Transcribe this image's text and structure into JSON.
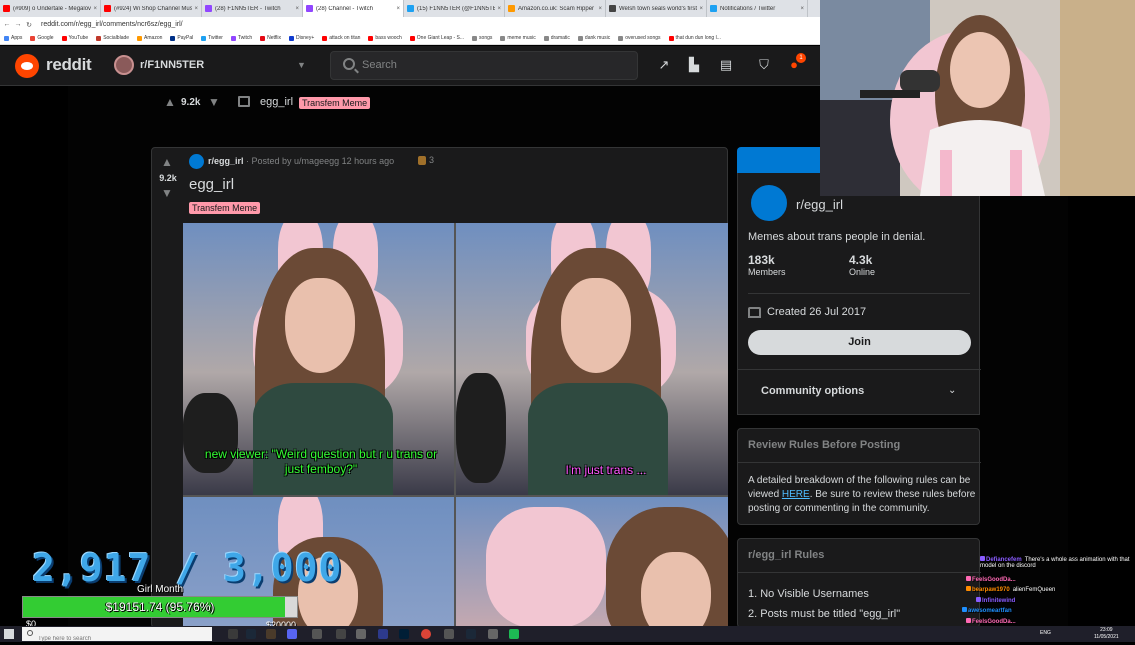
{
  "browser": {
    "tabs": [
      {
        "title": "(#909) o Undertale - Megalov...",
        "color": "#ff0000"
      },
      {
        "title": "(#924) Wi Shop Channel Musi...",
        "color": "#ff0000"
      },
      {
        "title": "(28) F1NN5TER - Twitch",
        "color": "#9146ff"
      },
      {
        "title": "(28) Channel - Twitch",
        "color": "#9146ff"
      },
      {
        "title": "(15) F1NN5TER (@F1NN5TER)...",
        "color": "#1da1f2"
      },
      {
        "title": "Amazon.co.uk: Scam Ripper",
        "color": "#ff9900"
      },
      {
        "title": "Welsh town seals world's first...",
        "color": "#444444"
      },
      {
        "title": "Notifications / Twitter",
        "color": "#1da1f2"
      }
    ],
    "url": "reddit.com/r/egg_irl/comments/ncr6sz/egg_irl/",
    "bookmarks": [
      {
        "label": "Apps",
        "color": "#4285f4"
      },
      {
        "label": "Google",
        "color": "#ea4335"
      },
      {
        "label": "YouTube",
        "color": "#ff0000"
      },
      {
        "label": "Socialblade",
        "color": "#c0392b"
      },
      {
        "label": "Amazon",
        "color": "#ff9900"
      },
      {
        "label": "PayPal",
        "color": "#003087"
      },
      {
        "label": "Twitter",
        "color": "#1da1f2"
      },
      {
        "label": "Twitch",
        "color": "#9146ff"
      },
      {
        "label": "Netflix",
        "color": "#e50914"
      },
      {
        "label": "Disney+",
        "color": "#113ccf"
      },
      {
        "label": "attack on titan",
        "color": "#ff0000"
      },
      {
        "label": "bass wooch",
        "color": "#ff0000"
      },
      {
        "label": "One Giant Leap - S...",
        "color": "#ff0000"
      },
      {
        "label": "songs",
        "color": "#888888"
      },
      {
        "label": "meme music",
        "color": "#888888"
      },
      {
        "label": "dramatic",
        "color": "#888888"
      },
      {
        "label": "dank music",
        "color": "#888888"
      },
      {
        "label": "overused songs",
        "color": "#888888"
      },
      {
        "label": "that dun dun long l...",
        "color": "#ff0000"
      }
    ]
  },
  "reddit": {
    "wordmark": "reddit",
    "subreddit_display": "r/F1NN5TER",
    "search_placeholder": "Search",
    "notification_count": "1",
    "sticky": {
      "score": "9.2k",
      "title": "egg_irl",
      "flair": "Transfem Meme"
    },
    "post": {
      "subreddit": "r/egg_irl",
      "meta": "· Posted by u/mageegg 12 hours ago",
      "award_count": "3",
      "score": "9.2k",
      "title": "egg_irl",
      "flair": "Transfem Meme",
      "caption_left": "new viewer: \"Weird question but r u trans or just femboy?\"",
      "caption_right": "I'm just trans ..."
    },
    "sidebar": {
      "name": "r/egg_irl",
      "description": "Memes about trans people in denial.",
      "members": "183k",
      "members_label": "Members",
      "online": "4.3k",
      "online_label": "Online",
      "created": "Created 26 Jul 2017",
      "join_label": "Join",
      "community_options": "Community options",
      "review_title": "Review Rules Before Posting",
      "review_text_pre": "A detailed breakdown of the following rules can be viewed ",
      "review_link": "HERE",
      "review_text_post": ". Be sure to review these rules before posting or commenting in the community.",
      "rules_title": "r/egg_irl Rules",
      "rules": [
        "1. No Visible Usernames",
        "2. Posts must be titled \"egg_irl\""
      ]
    }
  },
  "overlay": {
    "goal_count": "2,917 / 3,000",
    "goal_label": "Girl Month",
    "goal_amount": "$19151.74 (95.76%)",
    "goal_progress": 95.76,
    "goal_min": "$0",
    "goal_max": "$20000"
  },
  "chat": [
    {
      "user": "Defiancefem",
      "msg": "There's a whole ass animation with that model on the discord",
      "color": "#8a5cff"
    },
    {
      "user": "FeelsGoodDa...",
      "msg": "",
      "color": "#ff69b4"
    },
    {
      "user": "bearpaw1970",
      "msg": "alienFemQueen",
      "color": "#ff8c00"
    },
    {
      "user": "Infinitewind",
      "msg": "",
      "color": "#8a5cff"
    },
    {
      "user": "awesomeartfan",
      "msg": "",
      "color": "#1e90ff"
    },
    {
      "user": "FeelsGoodDa...",
      "msg": "",
      "color": "#ff69b4"
    }
  ],
  "taskbar": {
    "search_placeholder": "Type here to search",
    "time": "23:09",
    "date": "11/05/2021",
    "lang": "ENG"
  }
}
